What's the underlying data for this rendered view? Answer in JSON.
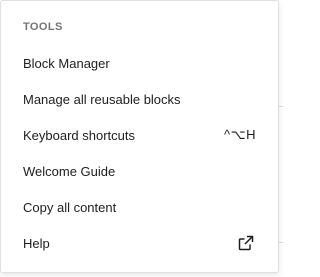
{
  "menu": {
    "group_label": "TOOLS",
    "items": [
      {
        "label": "Block Manager"
      },
      {
        "label": "Manage all reusable blocks"
      },
      {
        "label": "Keyboard shortcuts",
        "shortcut": "^⌥H"
      },
      {
        "label": "Welcome Guide"
      },
      {
        "label": "Copy all content"
      },
      {
        "label": "Help",
        "icon": "external-link-icon"
      }
    ]
  },
  "colors": {
    "text": "#1e1e1e",
    "muted": "#757575",
    "border": "#e0e0e0"
  }
}
